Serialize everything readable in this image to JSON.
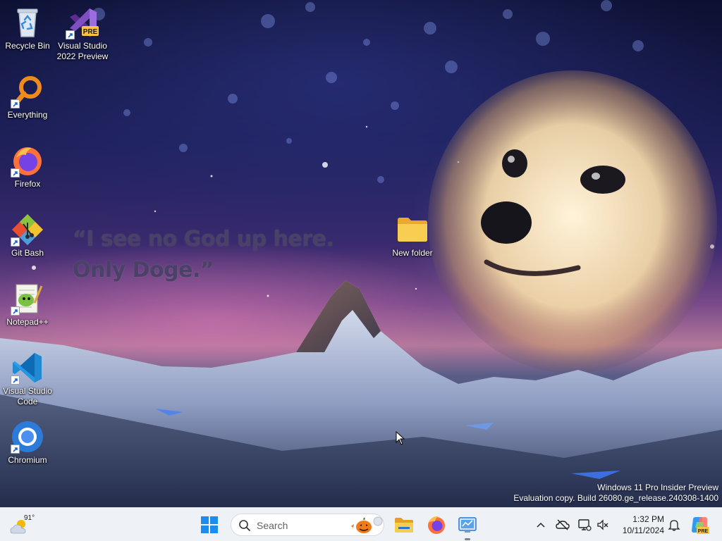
{
  "desktop": {
    "icons": [
      {
        "label": "Recycle Bin",
        "icon": "recycle-bin-icon"
      },
      {
        "label": "Visual Studio 2022 Preview",
        "icon": "visual-studio-preview-icon",
        "badge": "PRE"
      },
      {
        "label": "Everything",
        "icon": "everything-search-icon"
      },
      {
        "label": "Firefox",
        "icon": "firefox-icon"
      },
      {
        "label": "Git Bash",
        "icon": "git-bash-icon"
      },
      {
        "label": "Notepad++",
        "icon": "notepad-plus-plus-icon"
      },
      {
        "label": "Visual Studio Code",
        "icon": "vscode-icon"
      },
      {
        "label": "Chromium",
        "icon": "chromium-icon"
      },
      {
        "label": "New folder",
        "icon": "folder-icon"
      }
    ],
    "quote_line1": "“I see no God up here.",
    "quote_line2": "Only Doge.”",
    "watermark": {
      "line1": "Windows 11 Pro Insider Preview",
      "line2": "Evaluation copy. Build 26080.ge_release.240308-1400"
    }
  },
  "taskbar": {
    "weather": {
      "temp": "91°",
      "icon": "weather-sun-cloud-icon"
    },
    "start": {
      "icon": "windows-start-icon"
    },
    "search": {
      "placeholder": "Search",
      "icon": "search-icon",
      "highlight_icon": "halloween-pumpkin-icon"
    },
    "apps": [
      {
        "name": "File Explorer",
        "icon": "file-explorer-icon"
      },
      {
        "name": "Firefox",
        "icon": "firefox-icon"
      },
      {
        "name": "Control Panel",
        "icon": "control-panel-icon",
        "running": true
      }
    ],
    "tray": {
      "icons": [
        "chevron-up-icon",
        "onedrive-offline-icon",
        "network-icon",
        "volume-muted-icon",
        "notification-bell-icon",
        "copilot-pre-icon"
      ],
      "time": "1:32 PM",
      "date": "10/11/2024"
    }
  },
  "colors": {
    "taskbar_bg": "#eef1f6",
    "accent": "#0067c0",
    "folder": "#f2c94c"
  }
}
